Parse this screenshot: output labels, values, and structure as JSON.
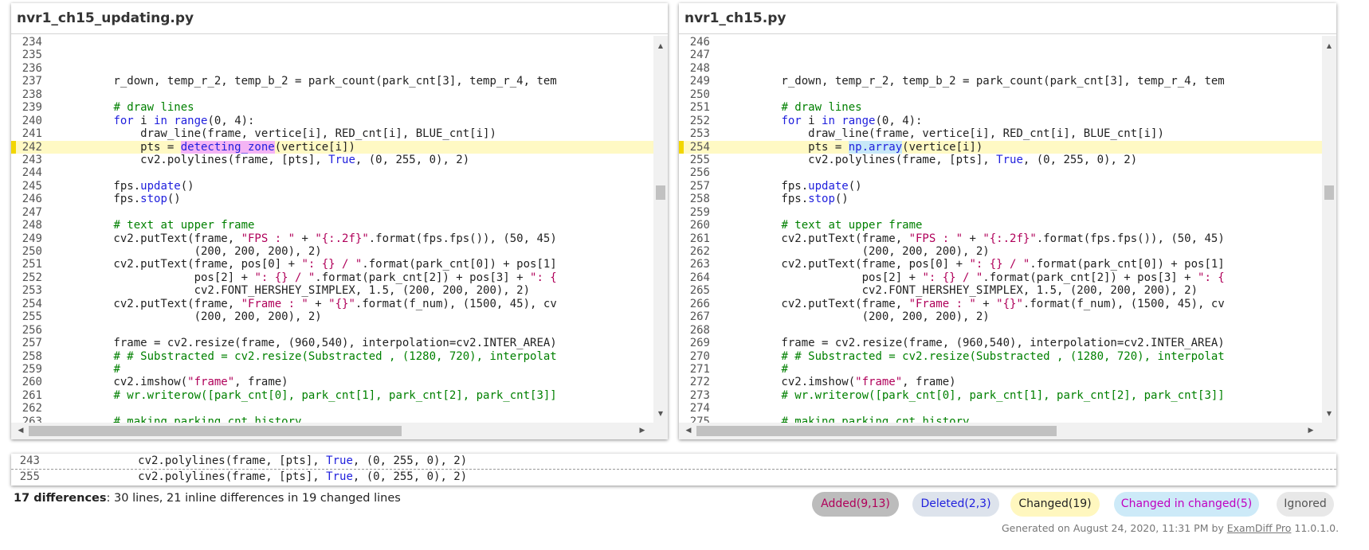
{
  "left": {
    "title": "nvr1_ch15_updating.py",
    "lines": [
      {
        "n": "234",
        "t": ""
      },
      {
        "n": "235",
        "t": ""
      },
      {
        "n": "236",
        "t": ""
      },
      {
        "n": "237",
        "t": "        r_down, temp_r_2, temp_b_2 = park_count(park_cnt[3], temp_r_4, tem"
      },
      {
        "n": "238",
        "t": ""
      },
      {
        "n": "239",
        "t": "        # draw lines"
      },
      {
        "n": "240",
        "t": "        for i in range(0, 4):"
      },
      {
        "n": "241",
        "t": "            draw_line(frame, vertice[i], RED_cnt[i], BLUE_cnt[i])"
      },
      {
        "n": "242",
        "t": "            pts = detecting_zone(vertice[i])",
        "hl": true
      },
      {
        "n": "243",
        "t": "            cv2.polylines(frame, [pts], True, (0, 255, 0), 2)"
      },
      {
        "n": "244",
        "t": ""
      },
      {
        "n": "245",
        "t": "        fps.update()"
      },
      {
        "n": "246",
        "t": "        fps.stop()"
      },
      {
        "n": "247",
        "t": ""
      },
      {
        "n": "248",
        "t": "        # text at upper frame"
      },
      {
        "n": "249",
        "t": "        cv2.putText(frame, \"FPS : \" + \"{:.2f}\".format(fps.fps()), (50, 45)"
      },
      {
        "n": "250",
        "t": "                    (200, 200, 200), 2)"
      },
      {
        "n": "251",
        "t": "        cv2.putText(frame, pos[0] + \": {} / \".format(park_cnt[0]) + pos[1]"
      },
      {
        "n": "252",
        "t": "                    pos[2] + \": {} / \".format(park_cnt[2]) + pos[3] + \": {"
      },
      {
        "n": "253",
        "t": "                    cv2.FONT_HERSHEY_SIMPLEX, 1.5, (200, 200, 200), 2)"
      },
      {
        "n": "254",
        "t": "        cv2.putText(frame, \"Frame : \" + \"{}\".format(f_num), (1500, 45), cv"
      },
      {
        "n": "255",
        "t": "                    (200, 200, 200), 2)"
      },
      {
        "n": "256",
        "t": ""
      },
      {
        "n": "257",
        "t": "        frame = cv2.resize(frame, (960,540), interpolation=cv2.INTER_AREA)"
      },
      {
        "n": "258",
        "t": "        # # Substracted = cv2.resize(Substracted , (1280, 720), interpolat"
      },
      {
        "n": "259",
        "t": "        #"
      },
      {
        "n": "260",
        "t": "        cv2.imshow(\"frame\", frame)"
      },
      {
        "n": "261",
        "t": "        # wr.writerow([park_cnt[0], park_cnt[1], park_cnt[2], park_cnt[3]]"
      },
      {
        "n": "262",
        "t": ""
      },
      {
        "n": "263",
        "t": "        # making parking_cnt_history"
      }
    ]
  },
  "right": {
    "title": "nvr1_ch15.py",
    "lines": [
      {
        "n": "246",
        "t": ""
      },
      {
        "n": "247",
        "t": ""
      },
      {
        "n": "248",
        "t": ""
      },
      {
        "n": "249",
        "t": "        r_down, temp_r_2, temp_b_2 = park_count(park_cnt[3], temp_r_4, tem"
      },
      {
        "n": "250",
        "t": ""
      },
      {
        "n": "251",
        "t": "        # draw lines"
      },
      {
        "n": "252",
        "t": "        for i in range(0, 4):"
      },
      {
        "n": "253",
        "t": "            draw_line(frame, vertice[i], RED_cnt[i], BLUE_cnt[i])"
      },
      {
        "n": "254",
        "t": "            pts = np.array(vertice[i])",
        "hl": true
      },
      {
        "n": "255",
        "t": "            cv2.polylines(frame, [pts], True, (0, 255, 0), 2)"
      },
      {
        "n": "256",
        "t": ""
      },
      {
        "n": "257",
        "t": "        fps.update()"
      },
      {
        "n": "258",
        "t": "        fps.stop()"
      },
      {
        "n": "259",
        "t": ""
      },
      {
        "n": "260",
        "t": "        # text at upper frame"
      },
      {
        "n": "261",
        "t": "        cv2.putText(frame, \"FPS : \" + \"{:.2f}\".format(fps.fps()), (50, 45)"
      },
      {
        "n": "262",
        "t": "                    (200, 200, 200), 2)"
      },
      {
        "n": "263",
        "t": "        cv2.putText(frame, pos[0] + \": {} / \".format(park_cnt[0]) + pos[1]"
      },
      {
        "n": "264",
        "t": "                    pos[2] + \": {} / \".format(park_cnt[2]) + pos[3] + \": {"
      },
      {
        "n": "265",
        "t": "                    cv2.FONT_HERSHEY_SIMPLEX, 1.5, (200, 200, 200), 2)"
      },
      {
        "n": "266",
        "t": "        cv2.putText(frame, \"Frame : \" + \"{}\".format(f_num), (1500, 45), cv"
      },
      {
        "n": "267",
        "t": "                    (200, 200, 200), 2)"
      },
      {
        "n": "268",
        "t": ""
      },
      {
        "n": "269",
        "t": "        frame = cv2.resize(frame, (960,540), interpolation=cv2.INTER_AREA)"
      },
      {
        "n": "270",
        "t": "        # # Substracted = cv2.resize(Substracted , (1280, 720), interpolat"
      },
      {
        "n": "271",
        "t": "        #"
      },
      {
        "n": "272",
        "t": "        cv2.imshow(\"frame\", frame)"
      },
      {
        "n": "273",
        "t": "        # wr.writerow([park_cnt[0], park_cnt[1], park_cnt[2], park_cnt[3]]"
      },
      {
        "n": "274",
        "t": ""
      },
      {
        "n": "275",
        "t": "        # making parking_cnt_history"
      }
    ]
  },
  "diff_view": [
    {
      "n": "243",
      "t": "            cv2.polylines(frame, [pts], True, (0, 255, 0), 2)"
    },
    {
      "n": "255",
      "t": "            cv2.polylines(frame, [pts], True, (0, 255, 0), 2)"
    }
  ],
  "summary": {
    "count_label": "17 differences",
    "detail": ": 30 lines, 21 inline differences in 19 changed lines"
  },
  "badges": {
    "added": "Added(9,13)",
    "deleted": "Deleted(2,3)",
    "changed": "Changed(19)",
    "changed_in_changed": "Changed in changed(5)",
    "ignored": "Ignored"
  },
  "footer": {
    "prefix": "Generated on August 24, 2020, 11:31 PM by ",
    "link": "ExamDiff Pro",
    "suffix": " 11.0.1.0."
  },
  "colors": {
    "highlight_line": "#fff9c4",
    "keyword": "#2020dd",
    "string": "#b0005a",
    "comment": "#008000"
  }
}
